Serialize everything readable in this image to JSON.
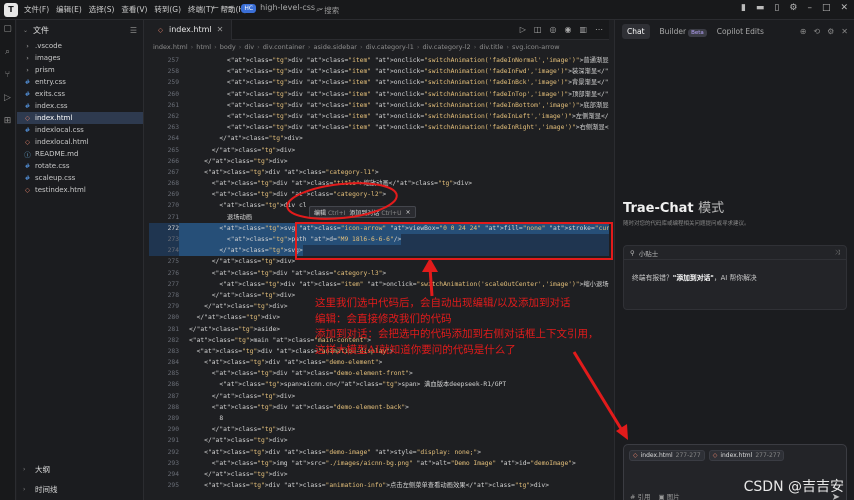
{
  "titlebar": {
    "logo": "T",
    "menu": [
      "文件(F)",
      "编辑(E)",
      "选择(S)",
      "查看(V)",
      "转到(G)",
      "终端(T)",
      "帮助(H)"
    ],
    "project_badge": "HC",
    "project_name": "high-level-css",
    "search_placeholder": "搜索"
  },
  "explorer": {
    "header": "文件",
    "items": [
      {
        "label": ".vscode",
        "type": "folder"
      },
      {
        "label": "images",
        "type": "folder"
      },
      {
        "label": "prism",
        "type": "folder"
      },
      {
        "label": "entry.css",
        "type": "css"
      },
      {
        "label": "exits.css",
        "type": "css"
      },
      {
        "label": "index.css",
        "type": "css"
      },
      {
        "label": "index.html",
        "type": "html",
        "active": true
      },
      {
        "label": "indexlocal.css",
        "type": "css"
      },
      {
        "label": "indexlocal.html",
        "type": "html"
      },
      {
        "label": "README.md",
        "type": "md"
      },
      {
        "label": "rotate.css",
        "type": "css"
      },
      {
        "label": "scaleup.css",
        "type": "css"
      },
      {
        "label": "testindex.html",
        "type": "html"
      }
    ],
    "outline_label": "大纲",
    "timeline_label": "时间线"
  },
  "editor": {
    "tab_label": "index.html",
    "breadcrumb": [
      "index.html",
      "html",
      "body",
      "div",
      "div.container",
      "aside.sidebar",
      "div.category-l1",
      "div.category-l2",
      "div.title",
      "svg.icon-arrow"
    ],
    "popup": {
      "edit": "编辑",
      "edit_key": "Ctrl+I",
      "add": "添加到对话",
      "add_key": "Ctrl+U"
    },
    "lines": [
      {
        "n": "257",
        "t": "          <div class=\"item\" onclick=\"switchAnimation('fadeInNormal','image')\">普通渐显</di"
      },
      {
        "n": "258",
        "t": "          <div class=\"item\" onclick=\"switchAnimation('fadeInFwd','image')\">装深渐显</div>"
      },
      {
        "n": "259",
        "t": "          <div class=\"item\" onclick=\"switchAnimation('fadeInBck','image')\">背景渐显</div>"
      },
      {
        "n": "260",
        "t": "          <div class=\"item\" onclick=\"switchAnimation('fadeInTop','image')\">顶部渐显</div>"
      },
      {
        "n": "261",
        "t": "          <div class=\"item\" onclick=\"switchAnimation('fadeInBottom','image')\">底部渐显</div>"
      },
      {
        "n": "262",
        "t": "          <div class=\"item\" onclick=\"switchAnimation('fadeInLeft','image')\">左侧渐显</div>"
      },
      {
        "n": "263",
        "t": "          <div class=\"item\" onclick=\"switchAnimation('fadeInRight','image')\">右侧渐显</div>"
      },
      {
        "n": "264",
        "t": "        </div>"
      },
      {
        "n": "265",
        "t": "      </div>"
      },
      {
        "n": "266",
        "t": "    </div>"
      },
      {
        "n": "267",
        "t": "    <div class=\"category-l1\">"
      },
      {
        "n": "268",
        "t": "      <div class=\"title\">缩放动画</div>"
      },
      {
        "n": "269",
        "t": "      <div class=\"category-l2\">"
      },
      {
        "n": "270",
        "t": "        <div cl"
      },
      {
        "n": "271",
        "t": "          退场动画"
      },
      {
        "n": "272",
        "t": "        <svg class=\"icon-arrow\" viewBox=\"0 0 24 24\" fill=\"none\" stroke=\"currentColor\" s",
        "sel": true,
        "cur": true
      },
      {
        "n": "273",
        "t": "          <path d=\"M9 18l6-6-6-6\"/>",
        "sel": true
      },
      {
        "n": "274",
        "t": "        </svg>",
        "sel": true
      },
      {
        "n": "275",
        "t": "      </div>"
      },
      {
        "n": "276",
        "t": "      <div class=\"category-l3\">"
      },
      {
        "n": "277",
        "t": "        <div class=\"item\" onclick=\"switchAnimation('scaleOutCenter','image')\">缩小退场动"
      },
      {
        "n": "278",
        "t": "      </div>"
      },
      {
        "n": "279",
        "t": "    </div>"
      },
      {
        "n": "280",
        "t": "  </div>"
      },
      {
        "n": "281",
        "t": "</aside>"
      },
      {
        "n": "282",
        "t": "<main class=\"main-content\">"
      },
      {
        "n": "283",
        "t": "  <div class=\"animation-display\">"
      },
      {
        "n": "284",
        "t": "    <div class=\"demo-element\">"
      },
      {
        "n": "285",
        "t": "      <div class=\"demo-element-front\">"
      },
      {
        "n": "286",
        "t": "        <span>aicnn.cn</span> 满血版本deepseek-R1/GPT"
      },
      {
        "n": "287",
        "t": "      </div>"
      },
      {
        "n": "288",
        "t": "      <div class=\"demo-element-back\">"
      },
      {
        "n": "289",
        "t": "        8"
      },
      {
        "n": "290",
        "t": "      </div>"
      },
      {
        "n": "291",
        "t": "    </div>"
      },
      {
        "n": "292",
        "t": "    <div class=\"demo-image\" style=\"display: none;\">"
      },
      {
        "n": "293",
        "t": "      <img src=\"./images/aicnn-bg.png\" alt=\"Demo Image\" id=\"demoImage\">"
      },
      {
        "n": "294",
        "t": "    </div>"
      },
      {
        "n": "295",
        "t": "    <div class=\"animation-info\">点击左侧菜单查看动画效果</div>"
      }
    ]
  },
  "annotation": [
    "这里我们选中代码后，会自动出现编辑/以及添加到对话",
    "编辑：会直接修改我们的代码",
    "添加到对话：会把选中的代码添加到右侧对话框上下文引用，",
    "这样大模型AI就知道你要问的代码是什么了"
  ],
  "right_panel": {
    "tabs": [
      "Chat",
      "Builder",
      "Copilot Edits"
    ],
    "beta": "Beta",
    "title": "Trae-Chat",
    "title_mode": "模式",
    "desc": "随时对您的代码库或编程相关问题提问或寻求建议。",
    "tip_head": "小贴士",
    "tip_pre": "终端有报错？",
    "tip_bold": "\"添加到对话\"",
    "tip_post": "，AI 帮你解决",
    "chips": [
      {
        "file": "index.html",
        "range": "277-277"
      },
      {
        "file": "index.html",
        "range": "277-277"
      }
    ],
    "ref_label": "# 引用",
    "image_label": "图片"
  },
  "watermark": "CSDN @吉吉安",
  "colors": {
    "annotation": "#e21b1b",
    "selection": "#264f78",
    "accent": "#3b6fd6"
  }
}
